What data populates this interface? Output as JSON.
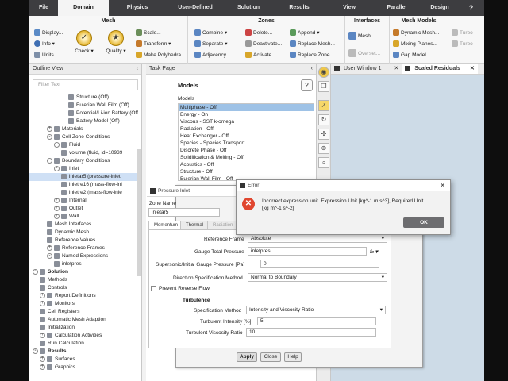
{
  "ribbon_tabs": [
    "File",
    "Domain",
    "Physics",
    "User-Defined",
    "Solution",
    "Results",
    "View",
    "Parallel",
    "Design"
  ],
  "active_tab": "Domain",
  "ribbon": {
    "mesh": {
      "title": "Mesh",
      "display": "Display...",
      "info": "Info",
      "units": "Units...",
      "check": "Check",
      "quality": "Quality",
      "scale": "Scale...",
      "transform": "Transform",
      "make_polyhedra": "Make Polyhedra"
    },
    "zones": {
      "title": "Zones",
      "combine": "Combine",
      "separate": "Separate",
      "adjacency": "Adjacency...",
      "delete": "Delete...",
      "deactivate": "Deactivate...",
      "activate": "Activate...",
      "append": "Append",
      "replace_mesh": "Replace Mesh...",
      "replace_zone": "Replace Zone..."
    },
    "interfaces": {
      "title": "Interfaces",
      "mesh": "Mesh...",
      "overset": "Overset..."
    },
    "mesh_models": {
      "title": "Mesh Models",
      "dynamic_mesh": "Dynamic Mesh...",
      "mixing_planes": "Mixing Planes...",
      "gap_model": "Gap Model..."
    },
    "turbo": {
      "title": "Turbo",
      "turbo1": "Turbo",
      "turbo2": "Turbo"
    }
  },
  "outline": {
    "title": "Outline View",
    "filter_placeholder": "Filter Text",
    "items": [
      {
        "label": "Structure (Off)",
        "indent": 5
      },
      {
        "label": "Eulerian Wall Film (Off)",
        "indent": 5
      },
      {
        "label": "Potential/Li-ion Battery (Off",
        "indent": 5
      },
      {
        "label": "Battery Model (Off)",
        "indent": 5
      },
      {
        "label": "Materials",
        "indent": 2,
        "exp": "+"
      },
      {
        "label": "Cell Zone Conditions",
        "indent": 2,
        "exp": "-"
      },
      {
        "label": "Fluid",
        "indent": 3,
        "exp": "-"
      },
      {
        "label": "volume (fluid, id=10939",
        "indent": 4
      },
      {
        "label": "Boundary Conditions",
        "indent": 2,
        "exp": "-"
      },
      {
        "label": "Inlet",
        "indent": 3,
        "exp": "-"
      },
      {
        "label": "inletar5 (pressure-inlet,",
        "indent": 4,
        "sel": true
      },
      {
        "label": "inletre16 (mass-flow-inl",
        "indent": 4
      },
      {
        "label": "inletre2 (mass-flow-inle",
        "indent": 4
      },
      {
        "label": "Internal",
        "indent": 3,
        "exp": "+"
      },
      {
        "label": "Outlet",
        "indent": 3,
        "exp": "+"
      },
      {
        "label": "Wall",
        "indent": 3,
        "exp": "+"
      },
      {
        "label": "Mesh Interfaces",
        "indent": 2
      },
      {
        "label": "Dynamic Mesh",
        "indent": 2
      },
      {
        "label": "Reference Values",
        "indent": 2
      },
      {
        "label": "Reference Frames",
        "indent": 2,
        "exp": "+"
      },
      {
        "label": "Named Expressions",
        "indent": 2,
        "exp": "-"
      },
      {
        "label": "inletpres",
        "indent": 3
      },
      {
        "label": "Solution",
        "indent": 0,
        "exp": "-",
        "bold": true
      },
      {
        "label": "Methods",
        "indent": 1
      },
      {
        "label": "Controls",
        "indent": 1
      },
      {
        "label": "Report Definitions",
        "indent": 1,
        "exp": "+"
      },
      {
        "label": "Monitors",
        "indent": 1,
        "exp": "+"
      },
      {
        "label": "Cell Registers",
        "indent": 1
      },
      {
        "label": "Automatic Mesh Adaption",
        "indent": 1
      },
      {
        "label": "Initialization",
        "indent": 1
      },
      {
        "label": "Calculation Activities",
        "indent": 1,
        "exp": "+"
      },
      {
        "label": "Run Calculation",
        "indent": 1
      },
      {
        "label": "Results",
        "indent": 0,
        "exp": "-",
        "bold": true
      },
      {
        "label": "Surfaces",
        "indent": 1,
        "exp": "+"
      },
      {
        "label": "Graphics",
        "indent": 1,
        "exp": "+"
      }
    ]
  },
  "task": {
    "title": "Task Page",
    "heading": "Models",
    "models_label": "Models",
    "models": [
      "Multiphase - Off",
      "Energy - On",
      "Viscous - SST k-omega",
      "Radiation - Off",
      "Heat Exchanger - Off",
      "Species - Species Transport",
      "Discrete Phase - Off",
      "Solidification & Melting - Off",
      "Acoustics - Off",
      "Structure - Off",
      "Eulerian Wall Film - Off"
    ],
    "selected_model": 0
  },
  "viewer": {
    "tab1": "User Window 1",
    "tab2": "Scaled Residuals"
  },
  "pressure_inlet": {
    "title": "Pressure Inlet",
    "zone_name_label": "Zone Name",
    "zone_name": "inletar5",
    "tabs": [
      "Momentum",
      "Thermal",
      "Radiation"
    ],
    "reference_frame_label": "Reference Frame",
    "reference_frame": "Absolute",
    "gauge_total_pressure_label": "Gauge Total Pressure",
    "gauge_total_pressure": "inletpres",
    "supersonic_label": "Supersonic/Initial Gauge Pressure [Pa]",
    "supersonic_value": "0",
    "direction_label": "Direction Specification Method",
    "direction_value": "Normal to Boundary",
    "prevent_reverse_flow": "Prevent Reverse Flow",
    "turbulence_label": "Turbulence",
    "spec_method_label": "Specification Method",
    "spec_method_value": "Intensity and Viscosity Ratio",
    "turb_intensity_label": "Turbulent Intensity [%]",
    "turb_intensity_value": "5",
    "turb_visc_label": "Turbulent Viscosity Ratio",
    "turb_visc_value": "10",
    "apply": "Apply",
    "close": "Close",
    "help": "Help"
  },
  "error_dialog": {
    "title": "Error",
    "message_line1": "Incorrect expression unit. Expression Unit [kg^-1 m s^3], Required Unit",
    "message_line2": "[kg m^-1 s^-2]",
    "ok": "OK"
  }
}
